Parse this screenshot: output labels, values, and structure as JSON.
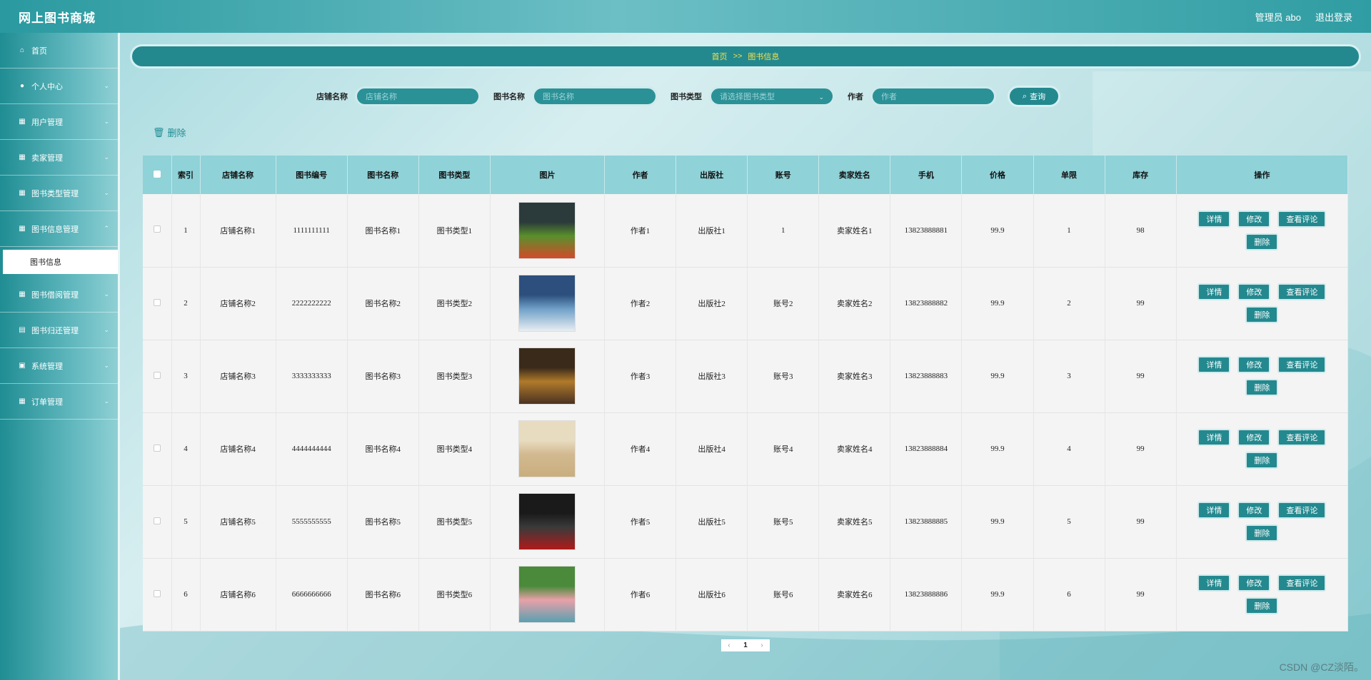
{
  "header": {
    "app_title": "网上图书商城",
    "admin_label": "管理员 abo",
    "logout_label": "退出登录"
  },
  "sidebar": {
    "items": [
      {
        "label": "首页",
        "icon": "home-icon"
      },
      {
        "label": "个人中心",
        "icon": "user-icon"
      },
      {
        "label": "用户管理",
        "icon": "grid-icon"
      },
      {
        "label": "卖家管理",
        "icon": "grid-icon"
      },
      {
        "label": "图书类型管理",
        "icon": "grid-icon"
      },
      {
        "label": "图书信息管理",
        "icon": "grid-icon"
      },
      {
        "label": "图书借阅管理",
        "icon": "grid-icon"
      },
      {
        "label": "图书归还管理",
        "icon": "calendar-icon"
      },
      {
        "label": "系统管理",
        "icon": "calendar-check-icon"
      },
      {
        "label": "订单管理",
        "icon": "grid-icon"
      }
    ],
    "active_sub": "图书信息"
  },
  "breadcrumb": {
    "home": "首页",
    "sep": ">>",
    "current": "图书信息"
  },
  "search": {
    "shop_label": "店铺名称",
    "shop_placeholder": "店铺名称",
    "book_label": "图书名称",
    "book_placeholder": "图书名称",
    "type_label": "图书类型",
    "type_placeholder": "请选择图书类型",
    "author_label": "作者",
    "author_placeholder": "作者",
    "button_label": "查询"
  },
  "delete_label": "删除",
  "table": {
    "headers": [
      "索引",
      "店铺名称",
      "图书编号",
      "图书名称",
      "图书类型",
      "图片",
      "作者",
      "出版社",
      "账号",
      "卖家姓名",
      "手机",
      "价格",
      "单限",
      "库存",
      "操作"
    ],
    "ops": [
      "详情",
      "修改",
      "查看评论",
      "删除"
    ],
    "rows": [
      {
        "index": "1",
        "shop": "店铺名称1",
        "code": "1111111111",
        "name": "图书名称1",
        "type": "图书类型1",
        "author": "作者1",
        "publisher": "出版社1",
        "account": "1",
        "seller": "卖家姓名1",
        "phone": "13823888881",
        "price": "99.9",
        "limit": "1",
        "stock": "98",
        "cover": {
          "top": "#2b3a3a",
          "mid": "#5a8f2c",
          "bottom": "#d24a2a"
        }
      },
      {
        "index": "2",
        "shop": "店铺名称2",
        "code": "2222222222",
        "name": "图书名称2",
        "type": "图书类型2",
        "author": "作者2",
        "publisher": "出版社2",
        "account": "账号2",
        "seller": "卖家姓名2",
        "phone": "13823888882",
        "price": "99.9",
        "limit": "2",
        "stock": "99",
        "cover": {
          "top": "#2c4f7d",
          "mid": "#6fa0c8",
          "bottom": "#e8eef2"
        }
      },
      {
        "index": "3",
        "shop": "店铺名称3",
        "code": "3333333333",
        "name": "图书名称3",
        "type": "图书类型3",
        "author": "作者3",
        "publisher": "出版社3",
        "account": "账号3",
        "seller": "卖家姓名3",
        "phone": "13823888883",
        "price": "99.9",
        "limit": "3",
        "stock": "99",
        "cover": {
          "top": "#3a2a1a",
          "mid": "#b07a2a",
          "bottom": "#4a3222"
        }
      },
      {
        "index": "4",
        "shop": "店铺名称4",
        "code": "4444444444",
        "name": "图书名称4",
        "type": "图书类型4",
        "author": "作者4",
        "publisher": "出版社4",
        "account": "账号4",
        "seller": "卖家姓名4",
        "phone": "13823888884",
        "price": "99.9",
        "limit": "4",
        "stock": "99",
        "cover": {
          "top": "#e8dcc0",
          "mid": "#d2b990",
          "bottom": "#c9ae7e"
        }
      },
      {
        "index": "5",
        "shop": "店铺名称5",
        "code": "5555555555",
        "name": "图书名称5",
        "type": "图书类型5",
        "author": "作者5",
        "publisher": "出版社5",
        "account": "账号5",
        "seller": "卖家姓名5",
        "phone": "13823888885",
        "price": "99.9",
        "limit": "5",
        "stock": "99",
        "cover": {
          "top": "#1a1a1a",
          "mid": "#3a3a3a",
          "bottom": "#b01a1a"
        }
      },
      {
        "index": "6",
        "shop": "店铺名称6",
        "code": "6666666666",
        "name": "图书名称6",
        "type": "图书类型6",
        "author": "作者6",
        "publisher": "出版社6",
        "account": "账号6",
        "seller": "卖家姓名6",
        "phone": "13823888886",
        "price": "99.9",
        "limit": "6",
        "stock": "99",
        "cover": {
          "top": "#4a8a3a",
          "mid": "#e8a0a8",
          "bottom": "#5aa0b0"
        }
      }
    ]
  },
  "pager": {
    "prev": "‹",
    "current": "1",
    "next": "›"
  },
  "watermark": "CSDN @CZ淡陌。",
  "colors": {
    "accent": "#23898f",
    "breadcrumb_text": "#f5e04a",
    "header_row": "#8fd2d8"
  }
}
